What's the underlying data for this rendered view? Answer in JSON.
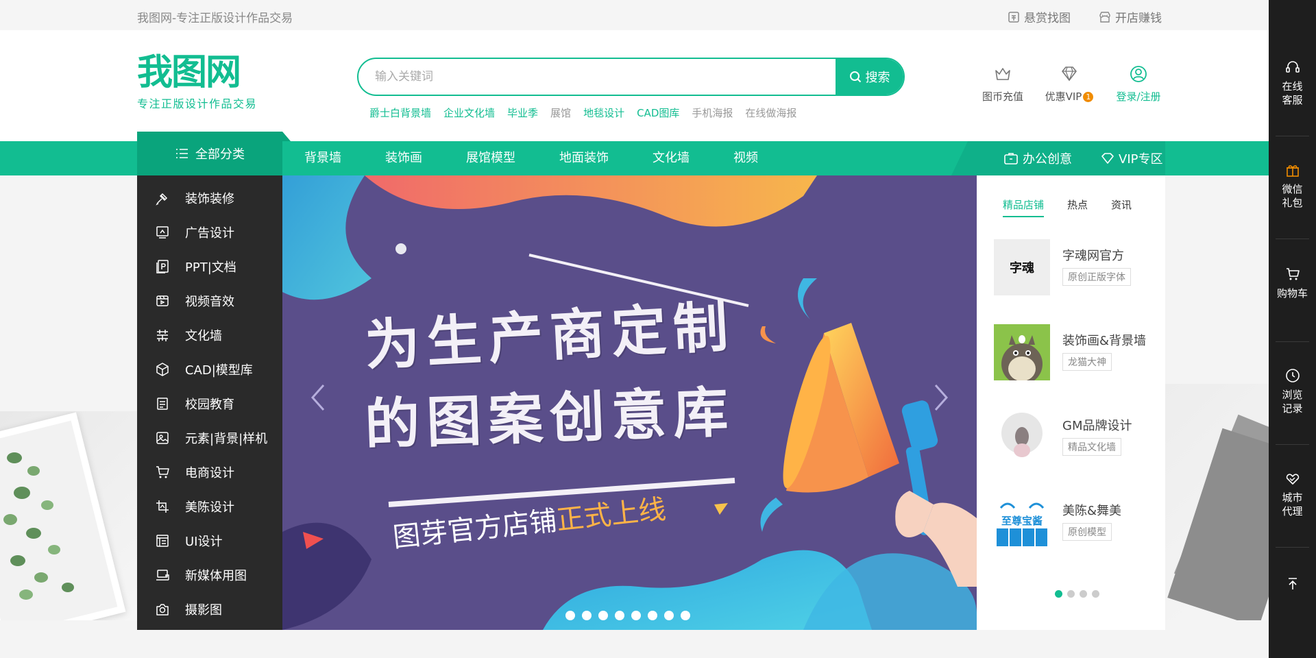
{
  "topbar": {
    "brand_line": "我图网-专注正版设计作品交易",
    "links": [
      {
        "label": "悬赏找图",
        "icon": "reward-icon"
      },
      {
        "label": "开店赚钱",
        "icon": "shop-icon"
      }
    ]
  },
  "header": {
    "logo_text": "我图网",
    "logo_slogan": "专注正版设计作品交易",
    "search": {
      "placeholder": "输入关键词",
      "button_label": "搜索"
    },
    "hot_words": [
      {
        "label": "爵士白背景墙",
        "highlight": true
      },
      {
        "label": "企业文化墙",
        "highlight": true
      },
      {
        "label": "毕业季",
        "highlight": true
      },
      {
        "label": "展馆",
        "highlight": false
      },
      {
        "label": "地毯设计",
        "highlight": true
      },
      {
        "label": "CAD图库",
        "highlight": true
      },
      {
        "label": "手机海报",
        "highlight": false
      },
      {
        "label": "在线做海报",
        "highlight": false
      }
    ],
    "actions": [
      {
        "label": "图币充值",
        "icon": "crown-icon"
      },
      {
        "label": "优惠VIP",
        "badge": "1",
        "icon": "diamond-icon"
      },
      {
        "label": "登录/注册",
        "icon": "user-icon"
      }
    ]
  },
  "nav": {
    "all_categories": "全部分类",
    "items": [
      "背景墙",
      "装饰画",
      "展馆模型",
      "地面装饰",
      "文化墙",
      "视频"
    ],
    "right": [
      {
        "label": "办公创意",
        "icon": "briefcase-icon"
      },
      {
        "label": "VIP专区",
        "icon": "vip-diamond-icon"
      }
    ]
  },
  "categories": [
    {
      "label": "装饰装修",
      "icon": "brush-icon"
    },
    {
      "label": "广告设计",
      "icon": "billboard-icon"
    },
    {
      "label": "PPT|文档",
      "icon": "ppt-icon"
    },
    {
      "label": "视频音效",
      "icon": "video-icon"
    },
    {
      "label": "文化墙",
      "icon": "wall-icon"
    },
    {
      "label": "CAD|模型库",
      "icon": "cube-icon"
    },
    {
      "label": "校园教育",
      "icon": "book-icon"
    },
    {
      "label": "元素|背景|样机",
      "icon": "image-icon"
    },
    {
      "label": "电商设计",
      "icon": "cart-icon"
    },
    {
      "label": "美陈设计",
      "icon": "crop-icon"
    },
    {
      "label": "UI设计",
      "icon": "ui-icon"
    },
    {
      "label": "新媒体用图",
      "icon": "laptop-icon"
    },
    {
      "label": "摄影图",
      "icon": "camera-icon"
    }
  ],
  "banner": {
    "headline_line1": "为生产商定制",
    "headline_line2": "的图案创意库",
    "subline_prefix": "图芽官方店铺",
    "subline_highlight": "正式上线",
    "dot_count": 8,
    "active_dot": 0,
    "colors": {
      "background": "#5a4e8a",
      "accent_orange": "#f7934c",
      "accent_blue": "#3bb4e6"
    }
  },
  "right_panel": {
    "tabs": [
      {
        "label": "精品店铺",
        "active": true
      },
      {
        "label": "热点",
        "active": false
      },
      {
        "label": "资讯",
        "active": false
      }
    ],
    "shops": [
      {
        "name": "字魂网官方",
        "tag": "原创正版字体",
        "thumb_text": "字魂"
      },
      {
        "name": "装饰画&背景墙",
        "tag": "龙猫大神",
        "thumb_text": ""
      },
      {
        "name": "GM品牌设计",
        "tag": "精品文化墙",
        "thumb_text": ""
      },
      {
        "name": "美陈&舞美",
        "tag": "原创模型",
        "thumb_text": "至尊宝酱"
      }
    ],
    "page_dots": 4,
    "active_page": 0
  },
  "side_toolbar": [
    {
      "label": "在线客服",
      "icon": "headset-icon"
    },
    {
      "label": "微信礼包",
      "icon": "gift-icon"
    },
    {
      "label": "购物车",
      "icon": "cart-icon"
    },
    {
      "label": "浏览记录",
      "icon": "clock-icon"
    },
    {
      "label": "城市代理",
      "icon": "handshake-icon"
    },
    {
      "label": "",
      "icon": "back-to-top-icon"
    }
  ],
  "colors": {
    "brand": "#12bd91",
    "dark": "#2a2a2a",
    "toolbar": "#1e1e1e",
    "vip_badge": "#f08c00"
  }
}
